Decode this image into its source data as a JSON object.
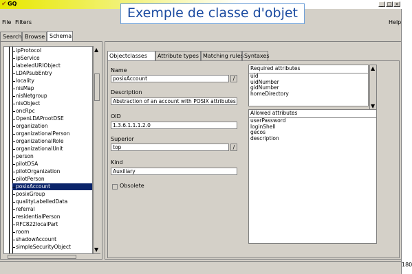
{
  "app": {
    "title": "GQ"
  },
  "slide": {
    "title": "Exemple de classe d'objet",
    "page_number": "180"
  },
  "window_controls": {
    "minimize": "_",
    "maximize": "□",
    "close": "×"
  },
  "menu": {
    "file": "File",
    "filters": "Filters",
    "help": "Help"
  },
  "main_tabs": [
    {
      "label": "Search"
    },
    {
      "label": "Browse"
    },
    {
      "label": "Schema"
    }
  ],
  "tree": {
    "items": [
      "ipProtocol",
      "ipService",
      "labeledURIObject",
      "LDAPsubEntry",
      "locality",
      "nisMap",
      "nisNetgroup",
      "nisObject",
      "oncRpc",
      "OpenLDAProotDSE",
      "organization",
      "organizationalPerson",
      "organizationalRole",
      "organizationalUnit",
      "person",
      "pilotDSA",
      "pilotOrganization",
      "pilotPerson",
      "posixAccount",
      "posixGroup",
      "qualityLabelledData",
      "referral",
      "residentialPerson",
      "RFC822localPart",
      "room",
      "shadowAccount",
      "simpleSecurityObject"
    ],
    "selected": "posixAccount"
  },
  "detail_tabs": [
    {
      "label": "Objectclasses"
    },
    {
      "label": "Attribute types"
    },
    {
      "label": "Matching rules"
    },
    {
      "label": "Syntaxes"
    }
  ],
  "form": {
    "name_label": "Name",
    "name_value": "posixAccount",
    "description_label": "Description",
    "description_value": "Abstraction of an account with POSIX attributes",
    "oid_label": "OID",
    "oid_value": "1.3.6.1.1.1.2.0",
    "superior_label": "Superior",
    "superior_value": "top",
    "kind_label": "Kind",
    "kind_value": "Auxiliary",
    "obsolete_label": "Obsolete",
    "edit_glyph": "/"
  },
  "required_attributes": {
    "header": "Required attributes",
    "items": [
      "uid",
      "uidNumber",
      "gidNumber",
      "homeDirectory"
    ]
  },
  "allowed_attributes": {
    "header": "Allowed attributes",
    "items": [
      "userPassword",
      "loginShell",
      "gecos",
      "description"
    ]
  },
  "colors": {
    "selection": "#0a246a",
    "titlebar": "#e8e800",
    "slide_title": "#1a4aa0"
  }
}
